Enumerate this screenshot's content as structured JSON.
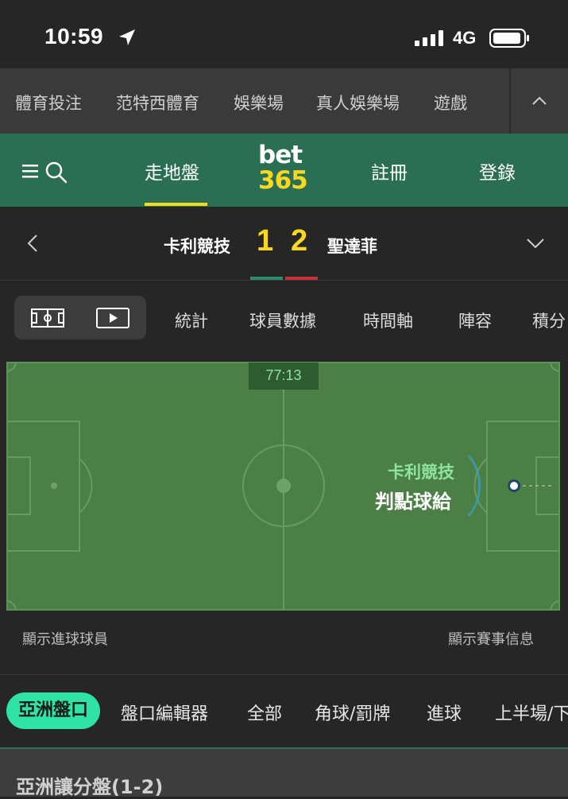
{
  "status_bar": {
    "time": "10:59",
    "network": "4G",
    "icons": [
      "location-arrow-icon",
      "signal-icon",
      "battery-icon"
    ]
  },
  "category_nav": {
    "items": [
      "體育投注",
      "范特西體育",
      "娛樂場",
      "真人娛樂場",
      "遊戲"
    ],
    "collapse_icon": "chevron-up-icon"
  },
  "header": {
    "menu_icon": "menu-icon",
    "search_icon": "search-icon",
    "inplay_label": "走地盤",
    "logo_top": "bet",
    "logo_bottom": "365",
    "register_label": "註冊",
    "login_label": "登錄"
  },
  "match": {
    "home_team": "卡利競技",
    "away_team": "聖達菲",
    "home_score": "1",
    "away_score": "2",
    "home_color": "#2e8a68",
    "away_color": "#c9303c"
  },
  "tabs": {
    "items": [
      "統計",
      "球員數據",
      "時間軸",
      "陣容",
      "積分"
    ]
  },
  "pitch": {
    "clock": "77:13",
    "event_team": "卡利競技",
    "event_text": "判點球給"
  },
  "links": {
    "show_scorers": "顯示進球球員",
    "show_match_info": "顯示賽事信息"
  },
  "market_filters": {
    "active": "亞洲盤口",
    "items": [
      "盤口編輯器",
      "全部",
      "角球/罰牌",
      "進球",
      "上半場/下"
    ]
  },
  "market": {
    "title": "亞洲讓分盤(1-2)"
  },
  "colors": {
    "brand_green": "#2a6f54",
    "brand_yellow": "#f9d91f",
    "accent_mint": "#2ee3a5",
    "pitch_green": "#4b7f45"
  }
}
